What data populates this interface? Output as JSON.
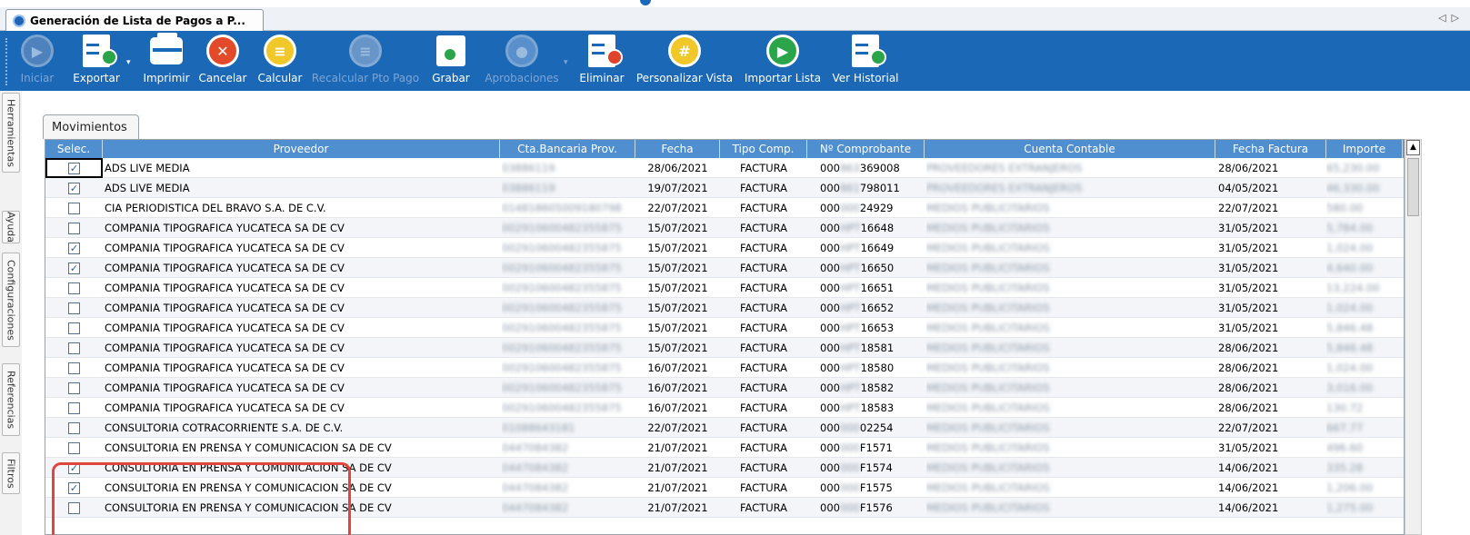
{
  "document_tab": {
    "title": "Generación de Lista de Pagos a P..."
  },
  "toolbar": {
    "buttons": [
      {
        "label": "Iniciar",
        "icon": "play-icon",
        "enabled": false
      },
      {
        "label": "Exportar",
        "icon": "export-icon",
        "enabled": true,
        "dropdown": true
      },
      {
        "label": "Imprimir",
        "icon": "printer-icon",
        "enabled": true
      },
      {
        "label": "Cancelar",
        "icon": "cancel-icon",
        "enabled": true
      },
      {
        "label": "Calcular",
        "icon": "calculate-icon",
        "enabled": true
      },
      {
        "label": "Recalcular Pto Pago",
        "icon": "recalculate-icon",
        "enabled": false
      },
      {
        "label": "Grabar",
        "icon": "save-icon",
        "enabled": true
      },
      {
        "label": "Aprobaciones",
        "icon": "approvals-icon",
        "enabled": false,
        "dropdown": true
      },
      {
        "label": "Eliminar",
        "icon": "delete-icon",
        "enabled": true
      },
      {
        "label": "Personalizar Vista",
        "icon": "customize-view-icon",
        "enabled": true
      },
      {
        "label": "Importar Lista",
        "icon": "import-icon",
        "enabled": true
      },
      {
        "label": "Ver Historial",
        "icon": "history-icon",
        "enabled": true
      }
    ]
  },
  "side_tabs": [
    "Herramientas",
    "Ayuda",
    "Configuraciones",
    "Referencias",
    "Filtros"
  ],
  "grid": {
    "tab_label": "Movimientos",
    "columns": [
      "Selec.",
      "Proveedor",
      "Cta.Bancaria Prov.",
      "Fecha",
      "Tipo Comp.",
      "Nº Comprobante",
      "Cuenta Contable",
      "Fecha Factura",
      "Importe"
    ],
    "rows": [
      {
        "sel": "✓",
        "proveedor": "ADS LIVE MEDIA",
        "cta": "03886119",
        "fecha": "28/06/2021",
        "tipo": "FACTURA",
        "comp_pre": "000",
        "comp_mask": "863",
        "comp_suf": "369008",
        "cuenta": "PROVEEDORES EXTRANJEROS",
        "fecha_fact": "28/06/2021",
        "importe": "65,230.00"
      },
      {
        "sel": "✓",
        "proveedor": "ADS LIVE MEDIA",
        "cta": "03886119",
        "fecha": "19/07/2021",
        "tipo": "FACTURA",
        "comp_pre": "000",
        "comp_mask": "861",
        "comp_suf": "798011",
        "cuenta": "PROVEEDORES EXTRANJEROS",
        "fecha_fact": "04/05/2021",
        "importe": "46,330.00"
      },
      {
        "sel": "",
        "proveedor": "CIA PERIODISTICA DEL BRAVO S.A. DE C.V.",
        "cta": "014818605009180798",
        "fecha": "22/07/2021",
        "tipo": "FACTURA",
        "comp_pre": "000",
        "comp_mask": "000",
        "comp_suf": "24929",
        "cuenta": "MEDIOS PUBLICITARIOS",
        "fecha_fact": "22/07/2021",
        "importe": "580.00"
      },
      {
        "sel": "",
        "proveedor": "COMPANIA TIPOGRAFICA YUCATECA SA DE CV",
        "cta": "002910600482355875",
        "fecha": "15/07/2021",
        "tipo": "FACTURA",
        "comp_pre": "000",
        "comp_mask": "HPT",
        "comp_suf": "16648",
        "cuenta": "MEDIOS PUBLICITARIOS",
        "fecha_fact": "31/05/2021",
        "importe": "5,784.00"
      },
      {
        "sel": "✓",
        "proveedor": "COMPANIA TIPOGRAFICA YUCATECA SA DE CV",
        "cta": "002910600482355875",
        "fecha": "15/07/2021",
        "tipo": "FACTURA",
        "comp_pre": "000",
        "comp_mask": "HPT",
        "comp_suf": "16649",
        "cuenta": "MEDIOS PUBLICITARIOS",
        "fecha_fact": "31/05/2021",
        "importe": "1,024.00"
      },
      {
        "sel": "✓",
        "proveedor": "COMPANIA TIPOGRAFICA YUCATECA SA DE CV",
        "cta": "002910600482355875",
        "fecha": "15/07/2021",
        "tipo": "FACTURA",
        "comp_pre": "000",
        "comp_mask": "HPT",
        "comp_suf": "16650",
        "cuenta": "MEDIOS PUBLICITARIOS",
        "fecha_fact": "31/05/2021",
        "importe": "4,640.00"
      },
      {
        "sel": "",
        "proveedor": "COMPANIA TIPOGRAFICA YUCATECA SA DE CV",
        "cta": "002910600482355875",
        "fecha": "15/07/2021",
        "tipo": "FACTURA",
        "comp_pre": "000",
        "comp_mask": "HPT",
        "comp_suf": "16651",
        "cuenta": "MEDIOS PUBLICITARIOS",
        "fecha_fact": "31/05/2021",
        "importe": "13,224.00"
      },
      {
        "sel": "",
        "proveedor": "COMPANIA TIPOGRAFICA YUCATECA SA DE CV",
        "cta": "002910600482355875",
        "fecha": "15/07/2021",
        "tipo": "FACTURA",
        "comp_pre": "000",
        "comp_mask": "HPT",
        "comp_suf": "16652",
        "cuenta": "MEDIOS PUBLICITARIOS",
        "fecha_fact": "31/05/2021",
        "importe": "1,024.00"
      },
      {
        "sel": "",
        "proveedor": "COMPANIA TIPOGRAFICA YUCATECA SA DE CV",
        "cta": "002910600482355875",
        "fecha": "15/07/2021",
        "tipo": "FACTURA",
        "comp_pre": "000",
        "comp_mask": "HPT",
        "comp_suf": "16653",
        "cuenta": "MEDIOS PUBLICITARIOS",
        "fecha_fact": "31/05/2021",
        "importe": "5,846.48"
      },
      {
        "sel": "",
        "proveedor": "COMPANIA TIPOGRAFICA YUCATECA SA DE CV",
        "cta": "002910600482355875",
        "fecha": "15/07/2021",
        "tipo": "FACTURA",
        "comp_pre": "000",
        "comp_mask": "HPT",
        "comp_suf": "18581",
        "cuenta": "MEDIOS PUBLICITARIOS",
        "fecha_fact": "28/06/2021",
        "importe": "5,846.48"
      },
      {
        "sel": "",
        "proveedor": "COMPANIA TIPOGRAFICA YUCATECA SA DE CV",
        "cta": "002910600482355875",
        "fecha": "16/07/2021",
        "tipo": "FACTURA",
        "comp_pre": "000",
        "comp_mask": "HPT",
        "comp_suf": "18580",
        "cuenta": "MEDIOS PUBLICITARIOS",
        "fecha_fact": "28/06/2021",
        "importe": "1,024.00"
      },
      {
        "sel": "",
        "proveedor": "COMPANIA TIPOGRAFICA YUCATECA SA DE CV",
        "cta": "002910600482355875",
        "fecha": "16/07/2021",
        "tipo": "FACTURA",
        "comp_pre": "000",
        "comp_mask": "HPT",
        "comp_suf": "18582",
        "cuenta": "MEDIOS PUBLICITARIOS",
        "fecha_fact": "28/06/2021",
        "importe": "3,016.00"
      },
      {
        "sel": "",
        "proveedor": "COMPANIA TIPOGRAFICA YUCATECA SA DE CV",
        "cta": "002910600482355875",
        "fecha": "16/07/2021",
        "tipo": "FACTURA",
        "comp_pre": "000",
        "comp_mask": "HPT",
        "comp_suf": "18583",
        "cuenta": "MEDIOS PUBLICITARIOS",
        "fecha_fact": "28/06/2021",
        "importe": "130.72"
      },
      {
        "sel": "",
        "proveedor": "CONSULTORIA COTRACORRIENTE S.A. DE C.V.",
        "cta": "01088643181",
        "fecha": "22/07/2021",
        "tipo": "FACTURA",
        "comp_pre": "000",
        "comp_mask": "000",
        "comp_suf": "02254",
        "cuenta": "MEDIOS PUBLICITARIOS",
        "fecha_fact": "22/07/2021",
        "importe": "667.77"
      },
      {
        "sel": "",
        "proveedor": "CONSULTORIA EN PRENSA Y COMUNICACION SA DE CV",
        "cta": "0447084382",
        "fecha": "21/07/2021",
        "tipo": "FACTURA",
        "comp_pre": "000",
        "comp_mask": "000",
        "comp_suf": "F1571",
        "cuenta": "MEDIOS PUBLICITARIOS",
        "fecha_fact": "31/05/2021",
        "importe": "496.60"
      },
      {
        "sel": "✓",
        "proveedor": "CONSULTORIA EN PRENSA Y COMUNICACION SA DE CV",
        "cta": "0447084382",
        "fecha": "21/07/2021",
        "tipo": "FACTURA",
        "comp_pre": "000",
        "comp_mask": "000",
        "comp_suf": "F1574",
        "cuenta": "MEDIOS PUBLICITARIOS",
        "fecha_fact": "14/06/2021",
        "importe": "335.28"
      },
      {
        "sel": "✓",
        "proveedor": "CONSULTORIA EN PRENSA Y COMUNICACION SA DE CV",
        "cta": "0447084382",
        "fecha": "21/07/2021",
        "tipo": "FACTURA",
        "comp_pre": "000",
        "comp_mask": "000",
        "comp_suf": "F1575",
        "cuenta": "MEDIOS PUBLICITARIOS",
        "fecha_fact": "14/06/2021",
        "importe": "1,206.00"
      },
      {
        "sel": "",
        "proveedor": "CONSULTORIA EN PRENSA Y COMUNICACION SA DE CV",
        "cta": "0447084382",
        "fecha": "21/07/2021",
        "tipo": "FACTURA",
        "comp_pre": "000",
        "comp_mask": "000",
        "comp_suf": "F1576",
        "cuenta": "MEDIOS PUBLICITARIOS",
        "fecha_fact": "14/06/2021",
        "importe": "1,275.00"
      }
    ]
  }
}
